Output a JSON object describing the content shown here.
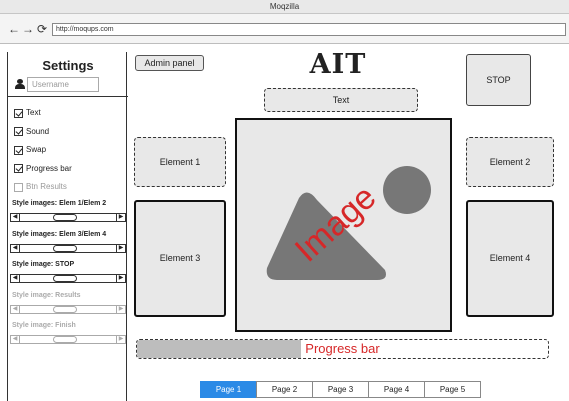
{
  "browser": {
    "window_title": "Moqzilla",
    "url": "http://moqups.com",
    "back_glyph": "←",
    "forward_glyph": "→",
    "reload_glyph": "⟳"
  },
  "sidebar": {
    "title": "Settings",
    "username_placeholder": "Username",
    "checkboxes": [
      {
        "label": "Text",
        "checked": true,
        "enabled": true
      },
      {
        "label": "Sound",
        "checked": true,
        "enabled": true
      },
      {
        "label": "Swap",
        "checked": true,
        "enabled": true
      },
      {
        "label": "Progress bar",
        "checked": true,
        "enabled": true
      },
      {
        "label": "Btn Results",
        "checked": false,
        "enabled": false
      }
    ],
    "style_sliders": [
      {
        "label": "Style images: Elem 1/Elem 2",
        "enabled": true
      },
      {
        "label": "Style images: Elem 3/Elem 4",
        "enabled": true
      },
      {
        "label": "Style image:  STOP",
        "enabled": true
      },
      {
        "label": "Style image: Results",
        "enabled": false
      },
      {
        "label": "Style image: Finish",
        "enabled": false
      }
    ],
    "arrow_left_glyph": "◀",
    "arrow_right_glyph": "▶"
  },
  "main": {
    "admin_button": "Admin panel",
    "logo": "AIT",
    "stop_button": "STOP",
    "text_box": "Text",
    "element1": "Element 1",
    "element2": "Element 2",
    "element3": "Element 3",
    "element4": "Element 4",
    "image_label": "Image",
    "progress_label": "Progress bar",
    "progress_fraction": 0.4
  },
  "pagination": {
    "pages": [
      "Page 1",
      "Page 2",
      "Page 3",
      "Page 4",
      "Page 5"
    ],
    "active_index": 0
  },
  "colors": {
    "accent": "#2b8ae6",
    "overlay_text": "#d62728",
    "placeholder_fill": "#e8e8e8",
    "image_shape": "#777777"
  }
}
